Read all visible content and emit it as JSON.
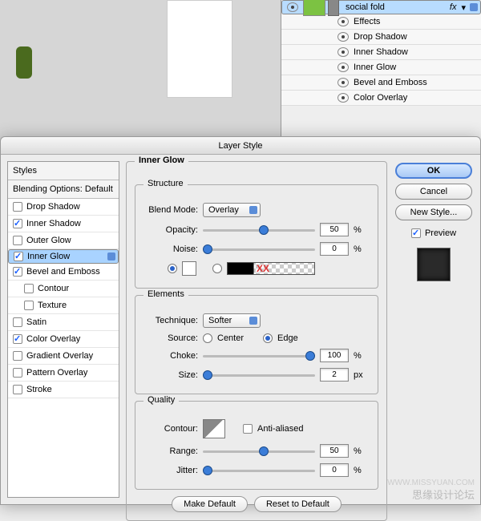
{
  "layers": {
    "layerName": "social fold",
    "fx": "fx",
    "effectsHeader": "Effects",
    "effects": [
      "Drop Shadow",
      "Inner Shadow",
      "Inner Glow",
      "Bevel and Emboss",
      "Color Overlay"
    ]
  },
  "dialog": {
    "title": "Layer Style",
    "left": {
      "styles": "Styles",
      "blending": "Blending Options: Default",
      "items": {
        "dropShadow": "Drop Shadow",
        "innerShadow": "Inner Shadow",
        "outerGlow": "Outer Glow",
        "innerGlow": "Inner Glow",
        "bevel": "Bevel and Emboss",
        "contour": "Contour",
        "texture": "Texture",
        "satin": "Satin",
        "colorOverlay": "Color Overlay",
        "gradOverlay": "Gradient Overlay",
        "patOverlay": "Pattern Overlay",
        "stroke": "Stroke"
      }
    },
    "mid": {
      "panel": "Inner Glow",
      "structure": {
        "title": "Structure",
        "blendModeLbl": "Blend Mode:",
        "blendMode": "Overlay",
        "opacityLbl": "Opacity:",
        "opacity": "50",
        "opacityUnit": "%",
        "noiseLbl": "Noise:",
        "noise": "0",
        "noiseUnit": "%"
      },
      "elements": {
        "title": "Elements",
        "techniqueLbl": "Technique:",
        "technique": "Softer",
        "sourceLbl": "Source:",
        "center": "Center",
        "edge": "Edge",
        "chokeLbl": "Choke:",
        "choke": "100",
        "chokeUnit": "%",
        "sizeLbl": "Size:",
        "size": "2",
        "sizeUnit": "px"
      },
      "quality": {
        "title": "Quality",
        "contourLbl": "Contour:",
        "aa": "Anti-aliased",
        "rangeLbl": "Range:",
        "range": "50",
        "rangeUnit": "%",
        "jitterLbl": "Jitter:",
        "jitter": "0",
        "jitterUnit": "%"
      },
      "makeDefault": "Make Default",
      "resetDefault": "Reset to Default"
    },
    "right": {
      "ok": "OK",
      "cancel": "Cancel",
      "newStyle": "New Style...",
      "preview": "Preview"
    }
  },
  "watermark": {
    "main": "思缘设计论坛",
    "url": "WWW.MISSYUAN.COM"
  },
  "chart_data": {
    "type": "table",
    "title": "Inner Glow settings",
    "rows": [
      {
        "param": "Blend Mode",
        "value": "Overlay"
      },
      {
        "param": "Opacity",
        "value": 50,
        "unit": "%"
      },
      {
        "param": "Noise",
        "value": 0,
        "unit": "%"
      },
      {
        "param": "Technique",
        "value": "Softer"
      },
      {
        "param": "Source",
        "value": "Edge"
      },
      {
        "param": "Choke",
        "value": 100,
        "unit": "%"
      },
      {
        "param": "Size",
        "value": 2,
        "unit": "px"
      },
      {
        "param": "Anti-aliased",
        "value": false
      },
      {
        "param": "Range",
        "value": 50,
        "unit": "%"
      },
      {
        "param": "Jitter",
        "value": 0,
        "unit": "%"
      }
    ]
  }
}
